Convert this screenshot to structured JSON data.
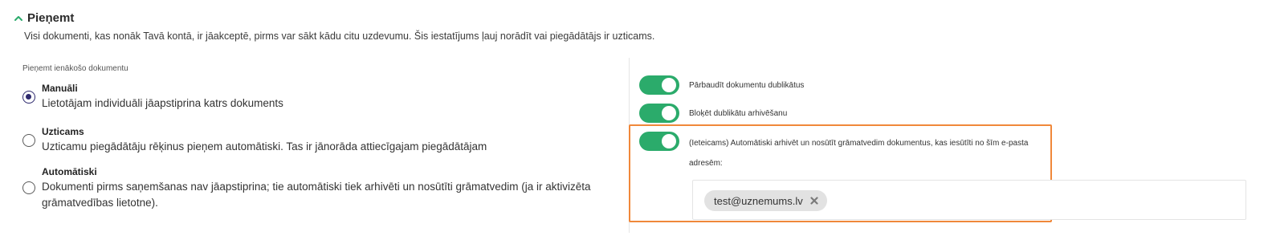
{
  "section": {
    "title": "Pieņemt",
    "description": "Visi dokumenti, kas nonāk Tavā kontā, ir jāakceptē, pirms var sākt kādu citu uzdevumu. Šis iestatījums ļauj norādīt vai piegādātājs ir uzticams."
  },
  "accept": {
    "field_label": "Pieņemt ienākošo dokumentu",
    "options": [
      {
        "title": "Manuāli",
        "description": "Lietotājam individuāli jāapstiprina katrs dokuments",
        "selected": true
      },
      {
        "title": "Uzticams",
        "description": "Uzticamu piegādātāju rēķinus pieņem automātiski. Tas ir jānorāda attiecīgajam piegādātājam",
        "selected": false
      },
      {
        "title": "Automātiski",
        "description": "Dokumenti pirms saņemšanas nav jāapstiprina; tie automātiski tiek arhivēti un nosūtīti grāmatvedim (ja ir aktivizēta grāmatvedības lietotne).",
        "selected": false
      }
    ]
  },
  "toggles": [
    {
      "label": "Pārbaudīt dokumentu dublikātus",
      "on": true
    },
    {
      "label": "Bloķēt dublikātu arhivēšanu",
      "on": true
    },
    {
      "label": "(Ieteicams) Automātiski arhivēt un nosūtīt grāmatvedim dokumentus, kas iesūtīti no šīm e-pasta adresēm:",
      "on": true
    }
  ],
  "emails": [
    {
      "address": "test@uznemums.lv"
    }
  ],
  "colors": {
    "toggle_on": "#2bab6b",
    "radio_selected": "#2e2a6e",
    "highlight_border": "#f0883a",
    "chevron": "#2bab6b"
  }
}
